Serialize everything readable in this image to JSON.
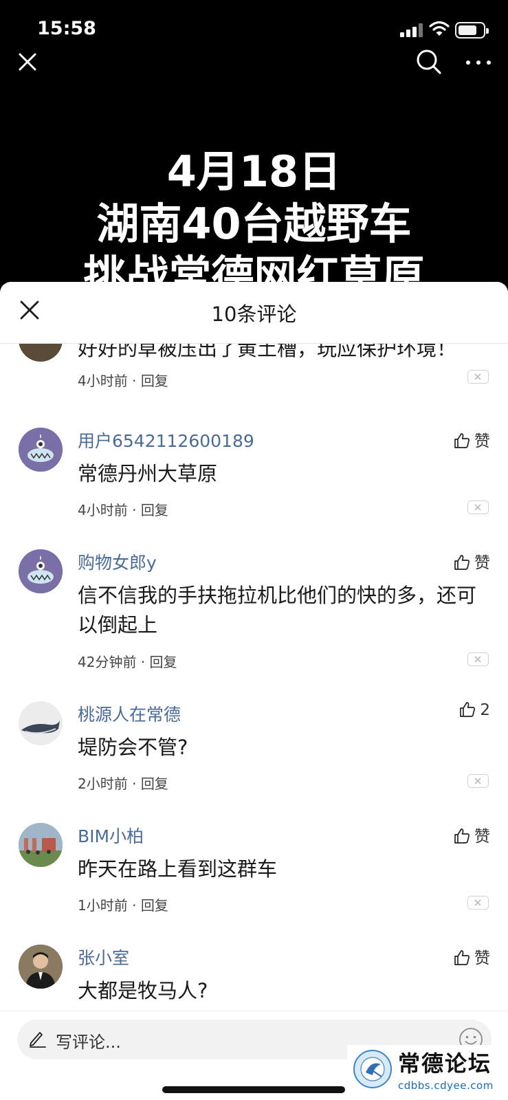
{
  "status_bar": {
    "time": "15:58"
  },
  "video": {
    "title_lines": [
      "4月18日",
      "湖南40台越野车",
      "挑战常德网红草原"
    ]
  },
  "sheet": {
    "title": "10条评论"
  },
  "comments": [
    {
      "username": "",
      "text": "好好的草被压出了黄土槽，玩应保护环境！",
      "time": "4小时前",
      "reply": "回复",
      "like": ""
    },
    {
      "username": "用户6542112600189",
      "text": "常德丹州大草原",
      "time": "4小时前",
      "reply": "回复",
      "like": "赞"
    },
    {
      "username": "购物女郎y",
      "text": "信不信我的手扶拖拉机比他们的快的多，还可以倒起上",
      "time": "42分钟前",
      "reply": "回复",
      "like": "赞"
    },
    {
      "username": "桃源人在常德",
      "text": "堤防会不管?",
      "time": "2小时前",
      "reply": "回复",
      "like": "2"
    },
    {
      "username": "BIM小柏",
      "text": "昨天在路上看到这群车",
      "time": "1小时前",
      "reply": "回复",
      "like": "赞"
    },
    {
      "username": "张小室",
      "text": "大都是牧马人?",
      "time": "",
      "reply": "",
      "like": "赞"
    }
  ],
  "meta_separator": " · ",
  "input": {
    "placeholder": "写评论..."
  },
  "watermark": {
    "title": "常德论坛",
    "url": "cdbbs.cdyee.com"
  },
  "colors": {
    "username": "#4a6a9a",
    "background_top": "#000000"
  }
}
